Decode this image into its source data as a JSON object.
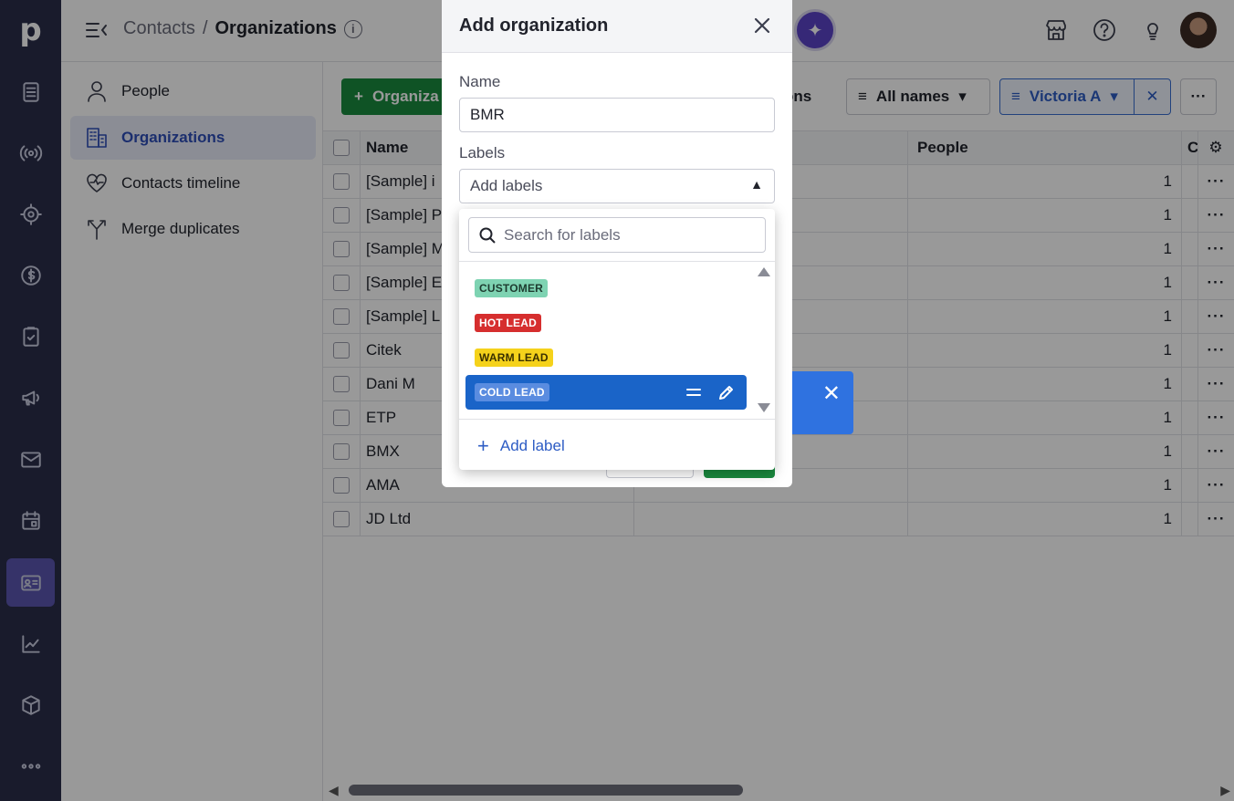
{
  "app": {
    "logo": "p"
  },
  "header": {
    "breadcrumb_parent": "Contacts",
    "breadcrumb_sep": "/",
    "breadcrumb_current": "Organizations",
    "info": "i"
  },
  "subnav": {
    "items": [
      {
        "label": "People",
        "icon": "person-icon"
      },
      {
        "label": "Organizations",
        "icon": "building-icon"
      },
      {
        "label": "Contacts timeline",
        "icon": "heart-pulse-icon"
      },
      {
        "label": "Merge duplicates",
        "icon": "merge-icon"
      }
    ]
  },
  "toolbar": {
    "add_button_label": "Organiza",
    "add_button_plus": "+",
    "partial_text": "ons",
    "filter_names": "All names",
    "filter_owner": "Victoria A",
    "more": "···"
  },
  "table": {
    "headers": {
      "name": "Name",
      "people": "People",
      "end": "C"
    },
    "rows": [
      {
        "name": "[Sample] i",
        "people": "1"
      },
      {
        "name": "[Sample] P",
        "people": "1"
      },
      {
        "name": "[Sample] M",
        "people": "1"
      },
      {
        "name": "[Sample] E",
        "people": "1"
      },
      {
        "name": "[Sample] L",
        "people": "1"
      },
      {
        "name": "Citek",
        "people": "1"
      },
      {
        "name": "Dani M",
        "people": "1"
      },
      {
        "name": "ETP",
        "people": "1"
      },
      {
        "name": "BMX",
        "people": "1"
      },
      {
        "name": "AMA",
        "people": "1"
      },
      {
        "name": "JD Ltd",
        "people": "1"
      }
    ],
    "row_menu": "···"
  },
  "modal": {
    "title": "Add organization",
    "name_label": "Name",
    "name_value": "BMR",
    "labels_label": "Labels",
    "labels_placeholder": "Add labels"
  },
  "dropdown": {
    "search_placeholder": "Search for labels",
    "options": [
      {
        "label": "CUSTOMER",
        "bg": "#7ed3b2",
        "fg": "#1d3b2f"
      },
      {
        "label": "HOT LEAD",
        "bg": "#d62e2e",
        "fg": "#ffffff"
      },
      {
        "label": "WARM LEAD",
        "bg": "#f5d21b",
        "fg": "#3a3000"
      },
      {
        "label": "COLD LEAD",
        "bg": "#5a8ce0",
        "fg": "#ffffff"
      }
    ],
    "selected_index": 3,
    "add_label": "Add label",
    "add_plus": "+"
  },
  "toast": {
    "close": "✕"
  },
  "colors": {
    "rail": "#2a2d4a",
    "primary_green": "#1a8a3e",
    "accent_blue": "#1a64c8"
  }
}
